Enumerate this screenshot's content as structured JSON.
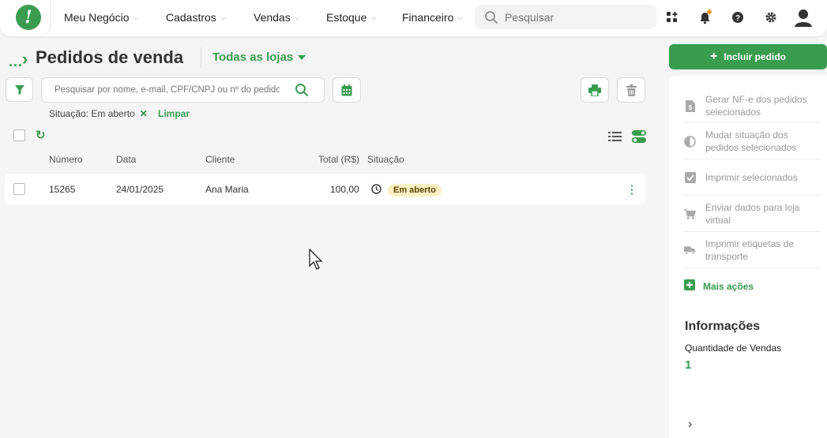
{
  "nav": {
    "items": [
      {
        "label": "Meu Negócio"
      },
      {
        "label": "Cadastros"
      },
      {
        "label": "Vendas"
      },
      {
        "label": "Estoque"
      },
      {
        "label": "Financeiro"
      }
    ],
    "search_placeholder": "Pesquisar"
  },
  "header": {
    "breadcrumb": "...",
    "title": "Pedidos de venda",
    "store": "Todas as lojas"
  },
  "search": {
    "placeholder": "Pesquisar por nome, e-mail, CPF/CNPJ ou nº do pedido"
  },
  "filter": {
    "chip": "Situação: Em aberto",
    "clear": "Limpar"
  },
  "table": {
    "columns": [
      "Número",
      "Data",
      "Cliente",
      "Total (R$)",
      "Situação"
    ],
    "rows": [
      {
        "numero": "15265",
        "data": "24/01/2025",
        "cliente": "Ana Maria",
        "total": "100,00",
        "situacao": "Em aberto"
      }
    ]
  },
  "panel": {
    "add_button": "Incluir pedido",
    "actions": [
      {
        "label": "Gerar NF-e dos pedidos selecionados"
      },
      {
        "label": "Mudar situação dos pedidos selecionados"
      },
      {
        "label": "Imprimir selecionados"
      },
      {
        "label": "Enviar dados para loja virtual"
      },
      {
        "label": "Imprimir etiquetas de transporte"
      }
    ],
    "more": "Mais ações",
    "info_title": "Informações",
    "info_label": "Quantidade de Vendas",
    "info_value": "1"
  },
  "colors": {
    "accent": "#3a9c4f",
    "badge_bg": "#fbefc4"
  }
}
